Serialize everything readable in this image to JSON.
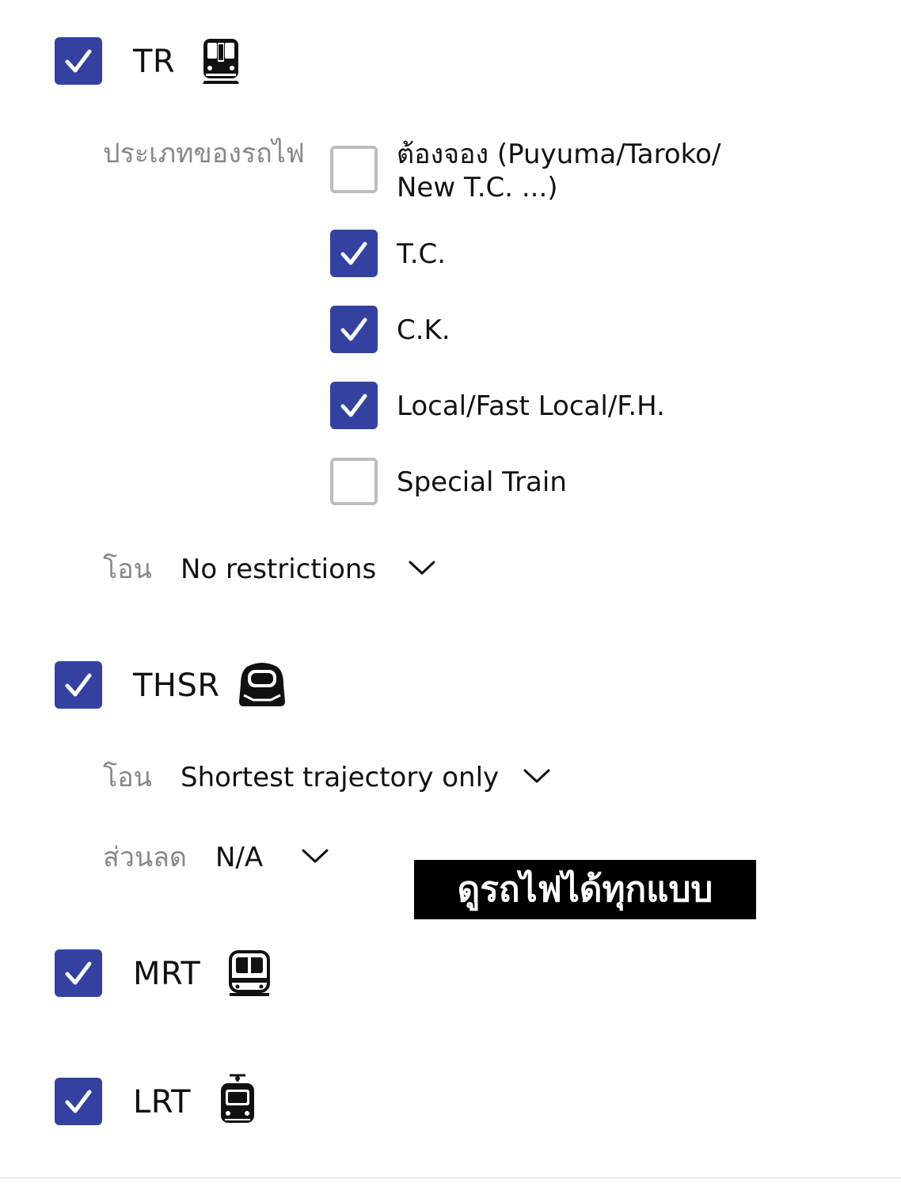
{
  "colors": {
    "checkbox_checked": "#3342a0",
    "checkbox_unchecked_border": "#bdbdbd",
    "secondary_text": "#888888",
    "banner_bg": "#000000",
    "banner_text": "#ffffff"
  },
  "tr": {
    "label": "TR",
    "checked": true,
    "icon": "train-front-icon",
    "train_types_label": "ประเภทของรถไฟ",
    "train_types": [
      {
        "line1": "ต้องจอง (Puyuma/Taroko/",
        "line2": "New T.C. ...)",
        "checked": false
      },
      {
        "line1": "T.C.",
        "checked": true
      },
      {
        "line1": "C.K.",
        "checked": true
      },
      {
        "line1": "Local/Fast Local/F.H.",
        "checked": true
      },
      {
        "line1": "Special Train",
        "checked": false
      }
    ],
    "transfer_label": "โอน",
    "transfer_value": "No restrictions"
  },
  "thsr": {
    "label": "THSR",
    "checked": true,
    "icon": "bullet-train-icon",
    "transfer_label": "โอน",
    "transfer_value": "Shortest trajectory only",
    "discount_label": "ส่วนลด",
    "discount_value": "N/A"
  },
  "mrt": {
    "label": "MRT",
    "checked": true,
    "icon": "metro-icon"
  },
  "lrt": {
    "label": "LRT",
    "checked": true,
    "icon": "tram-icon"
  },
  "banner": {
    "text": "ดูรถไฟได้ทุกแบบ"
  }
}
